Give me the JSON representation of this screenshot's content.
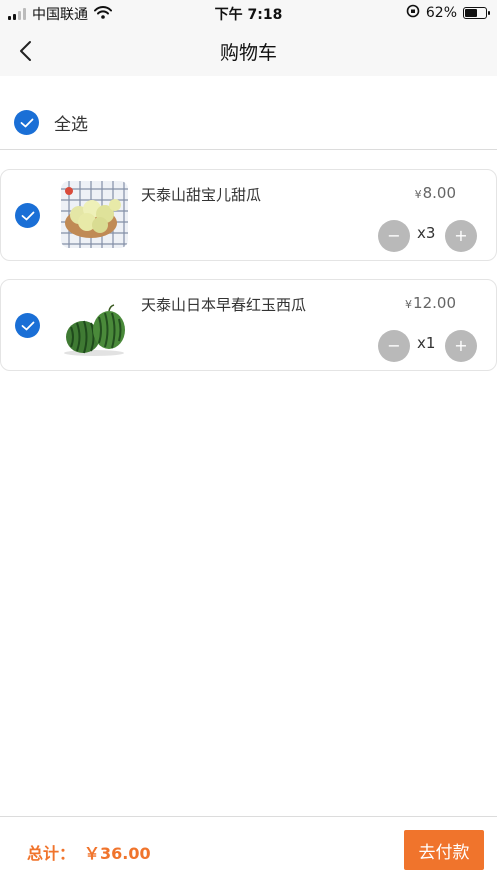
{
  "status_bar": {
    "carrier": "中国联通",
    "time": "下午 7:18",
    "battery": "62%",
    "battery_level": 0.62,
    "icons": [
      "signal-icon",
      "wifi-icon",
      "orientation-lock-icon",
      "battery-icon"
    ]
  },
  "nav": {
    "title": "购物车",
    "back_icon": "back-chevron-icon"
  },
  "select_all": {
    "label": "全选",
    "checked": true
  },
  "cart": {
    "currency": "¥",
    "items": [
      {
        "name": "天泰山甜宝儿甜瓜",
        "price": "8.00",
        "quantity": "x3",
        "minus": "−",
        "plus": "+",
        "checked": true,
        "image": "melon-image"
      },
      {
        "name": "天泰山日本早春红玉西瓜",
        "price": "12.00",
        "quantity": "x1",
        "minus": "−",
        "plus": "+",
        "checked": true,
        "image": "watermelon-image"
      }
    ]
  },
  "footer": {
    "total_label": "总计：",
    "total_value": "￥36.00",
    "checkout_label": "去付款"
  },
  "colors": {
    "accent": "#f0742c",
    "check": "#1a6fd6",
    "stepper": "#b9b9b9"
  }
}
